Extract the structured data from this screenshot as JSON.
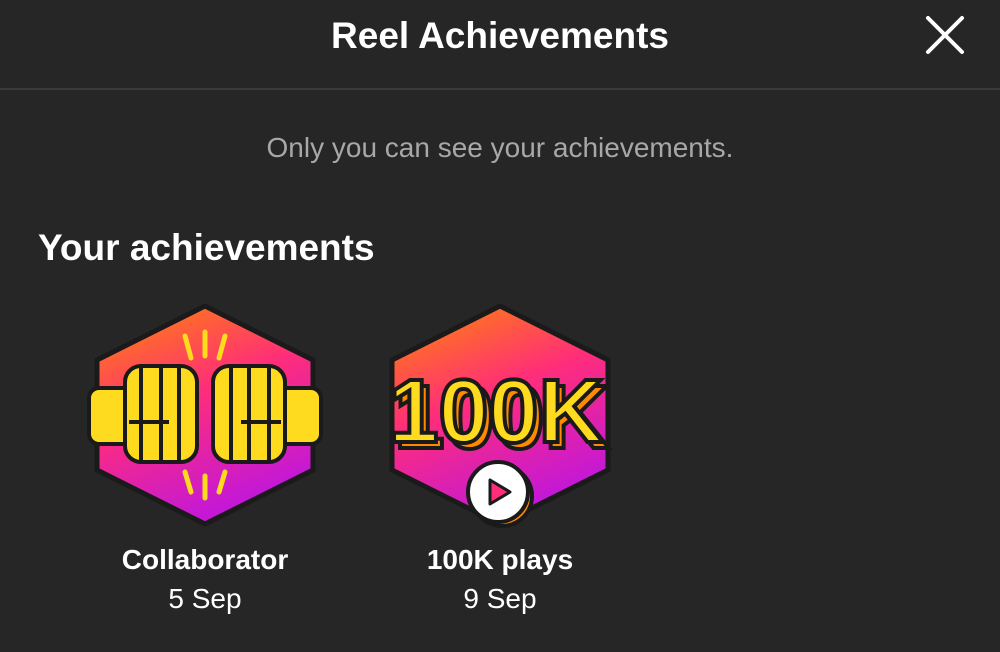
{
  "header": {
    "title": "Reel Achievements",
    "close_icon": "close-icon"
  },
  "subtitle": "Only you can see your achievements.",
  "section_title": "Your achievements",
  "achievements": [
    {
      "name": "Collaborator",
      "date": "5 Sep",
      "icon": "fist-bump-icon"
    },
    {
      "name": "100K plays",
      "date": "9 Sep",
      "icon": "100k-plays-icon",
      "badge_text": "100K"
    }
  ],
  "colors": {
    "background": "#262626",
    "text_primary": "#ffffff",
    "text_secondary": "#a8a8a8",
    "divider": "#3a3a3a",
    "gradient_orange": "#ff8a00",
    "gradient_pink": "#ff2d7a",
    "gradient_purple": "#c418d6",
    "badge_yellow": "#ffdb1f"
  }
}
